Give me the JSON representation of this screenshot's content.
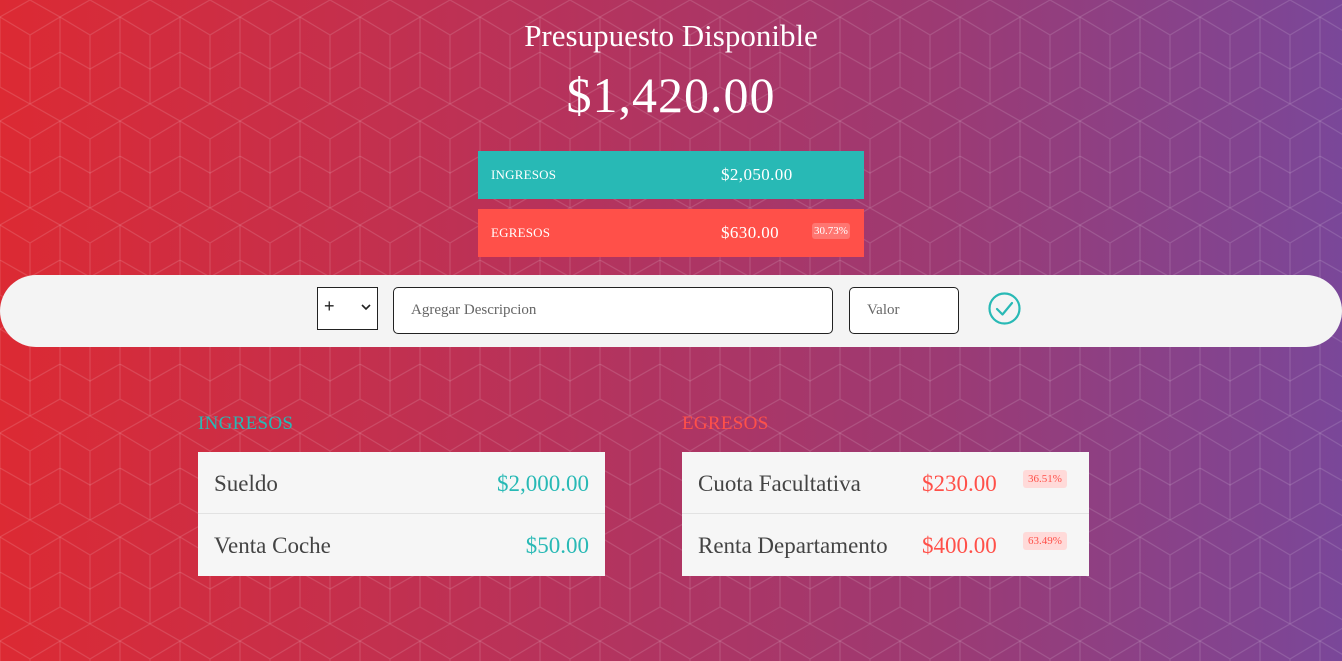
{
  "header": {
    "title": "Presupuesto Disponible",
    "total": "$1,420.00"
  },
  "summary": {
    "income": {
      "label": "INGRESOS",
      "value": "$2,050.00",
      "color": "#28b9b5"
    },
    "expense": {
      "label": "EGRESOS",
      "value": "$630.00",
      "percent": "30.73%",
      "color": "#ff5049"
    }
  },
  "form": {
    "type_selected": "+",
    "description_placeholder": "Agregar Descripcion",
    "value_placeholder": "Valor",
    "submit_icon": "checkmark-circle-icon"
  },
  "income_list": {
    "title": "INGRESOS",
    "items": [
      {
        "description": "Sueldo",
        "value": "$2,000.00"
      },
      {
        "description": "Venta Coche",
        "value": "$50.00"
      }
    ]
  },
  "expense_list": {
    "title": "EGRESOS",
    "items": [
      {
        "description": "Cuota Facultativa",
        "value": "$230.00",
        "percent": "36.51%"
      },
      {
        "description": "Renta Departamento",
        "value": "$400.00",
        "percent": "63.49%"
      }
    ]
  }
}
